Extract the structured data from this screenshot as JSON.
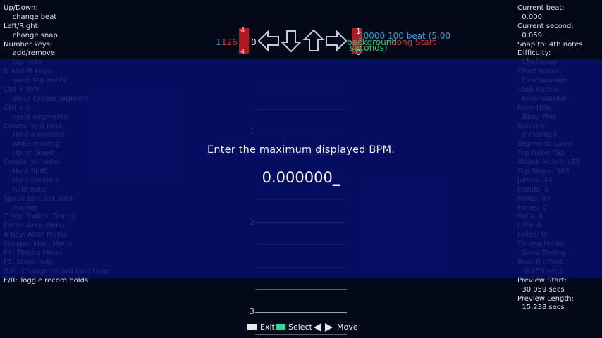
{
  "left_help": [
    "Up/Down:",
    "    change beat",
    "Left/Right:",
    "    change snap",
    "Number keys:",
    "    add/remove",
    "    tap note",
    "N and M keys:",
    "    swap tap notes",
    "Ctrl + N/M:",
    "    swap cycled segment",
    "Ctrl + J:",
    "    cycle segments",
    "Create hold note:",
    "    Hold a number",
    "    while moving",
    "    Up or Down",
    "Create roll note:",
    "    Hold Shift,",
    "    then create a",
    "    hold note.",
    "Space bar: Set area",
    "    marker",
    "T key: Switch Timing",
    "Enter: Area Menu",
    "A Key: Alter Menu",
    "Escape: Main Menu",
    "F4: Timing Menu",
    "F1: Show help",
    "G/H: Change record hold time",
    "E/R: Toggle record holds"
  ],
  "right_help": [
    "Current beat:",
    "  0.000",
    "Current second:",
    "  0.059",
    "Snap to: 4th notes",
    "Difficulty:",
    "  Challenge",
    "Chart Name:",
    "  Exschwasion",
    "Step Author:",
    "  Exschwasion",
    "Main title:",
    "  Baby Pink",
    "Subtitle:",
    "  2 Planned",
    "Segment: Label",
    "Tap Note: Tap",
    "Attack Note?: YES",
    "Tap Steps: 503",
    "Jumps: 44",
    "Hands: 0",
    "Holds: 87",
    "Mines: 0",
    "Rolls: 0",
    "Lifts: 0",
    "Fakes: 0",
    "Timing Mode:",
    "  Song Timing",
    "Beat 0 offset:",
    "  -0.059 secs",
    "Preview Start:",
    "  30.059 secs",
    "Preview Length:",
    "  15.238 secs"
  ],
  "top_labels": {
    "left_blue": "1",
    "left_red": "126",
    "tick_4a": "4",
    "tick_4b": "4",
    "zero_left": "0",
    "right_one": "1",
    "right_zero": "0",
    "bpm_text": "30000 100 beat (5.00",
    "seconds_text": "seconds)",
    "background_text": "background",
    "song_start_text": "Song Start"
  },
  "measures": [
    "1",
    "2",
    "3"
  ],
  "dialog": {
    "prompt": "Enter the maximum displayed BPM.",
    "value": "0.000000_"
  },
  "hints": {
    "exit": "Exit",
    "select": "Select",
    "move": "Move"
  },
  "colors": {
    "overlay": "#06106e",
    "select_key": "#2fd99a",
    "exit_key": "#e8e8e8",
    "bpm_green": "#2ecc71",
    "stop_red": "#e0303a",
    "blue_num": "#3b8fe0"
  }
}
